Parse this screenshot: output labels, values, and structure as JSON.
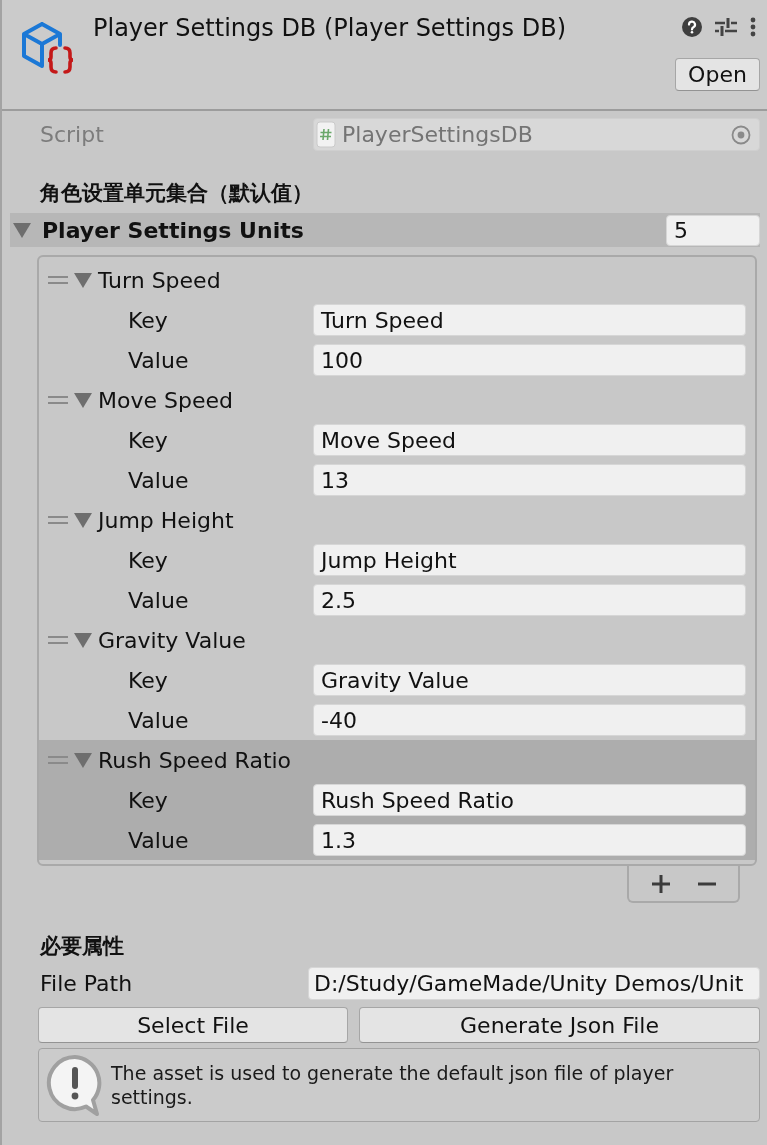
{
  "inspector_header": {
    "title": "Player Settings DB (Player Settings DB)",
    "open_button": "Open"
  },
  "script_field": {
    "label": "Script",
    "value": "PlayerSettingsDB",
    "disabled": true
  },
  "units_section": {
    "heading": "角色设置单元集合（默认值）",
    "list": {
      "label": "Player Settings Units",
      "expanded": true,
      "size": "5",
      "elements": [
        {
          "name": "Turn Speed",
          "expanded": true,
          "selected": false,
          "fields": [
            {
              "label": "Key",
              "value": "Turn Speed"
            },
            {
              "label": "Value",
              "value": "100"
            }
          ]
        },
        {
          "name": "Move Speed",
          "expanded": true,
          "selected": false,
          "fields": [
            {
              "label": "Key",
              "value": "Move Speed"
            },
            {
              "label": "Value",
              "value": "13"
            }
          ]
        },
        {
          "name": "Jump Height",
          "expanded": true,
          "selected": false,
          "fields": [
            {
              "label": "Key",
              "value": "Jump Height"
            },
            {
              "label": "Value",
              "value": "2.5"
            }
          ]
        },
        {
          "name": "Gravity Value",
          "expanded": true,
          "selected": false,
          "fields": [
            {
              "label": "Key",
              "value": "Gravity Value"
            },
            {
              "label": "Value",
              "value": "-40"
            }
          ]
        },
        {
          "name": "Rush Speed Ratio",
          "expanded": true,
          "selected": true,
          "fields": [
            {
              "label": "Key",
              "value": "Rush Speed Ratio"
            },
            {
              "label": "Value",
              "value": "1.3"
            }
          ]
        }
      ]
    }
  },
  "required_section": {
    "heading": "必要属性",
    "file_path": {
      "label": "File Path",
      "value": "D:/Study/GameMade/Unity Demos/Unit"
    },
    "buttons": [
      "Select File",
      "Generate Json File"
    ],
    "help_box": {
      "kind": "info",
      "message": "The asset is used to generate the default json file of player settings."
    }
  }
}
